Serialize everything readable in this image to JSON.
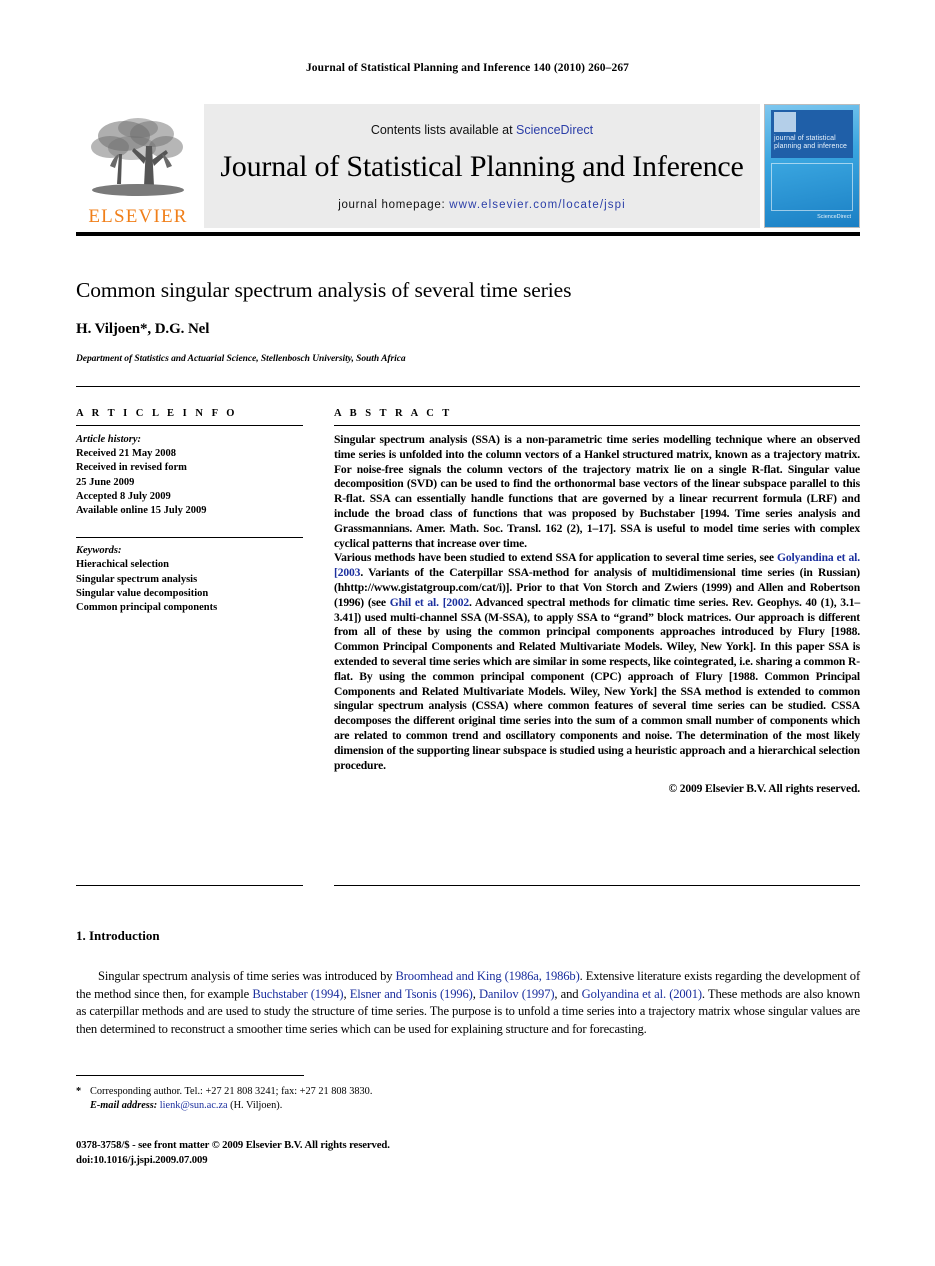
{
  "running_head": "Journal of Statistical Planning and Inference 140 (2010) 260–267",
  "masthead": {
    "publisher_name": "ELSEVIER",
    "contents_prefix": "Contents lists available at ",
    "contents_link": "ScienceDirect",
    "journal_title": "Journal of Statistical Planning and Inference",
    "homepage_prefix": "journal homepage: ",
    "homepage_url": "www.elsevier.com/locate/jspi",
    "cover": {
      "journal_name_lines": "journal of statistical planning and inference",
      "badge": "ScienceDirect"
    },
    "link_color": "#2b3ea8",
    "elsevier_orange": "#F07F1A"
  },
  "title_block": {
    "title": "Common singular spectrum analysis of several time series",
    "authors": "H. Viljoen*, D.G. Nel",
    "affiliation": "Department of Statistics and Actuarial Science, Stellenbosch University, South Africa"
  },
  "article_info": {
    "heading": "A R T I C L E   I N F O",
    "history_label": "Article history:",
    "history_lines": [
      "Received 21 May 2008",
      "Received in revised form",
      "25 June 2009",
      "Accepted 8 July 2009",
      "Available online 15 July 2009"
    ],
    "keywords_label": "Keywords:",
    "keywords": [
      "Hierachical selection",
      "Singular spectrum analysis",
      "Singular value decomposition",
      "Common principal components"
    ]
  },
  "abstract": {
    "heading": "A B S T R A C T",
    "paragraph1_part1": "Singular spectrum analysis (SSA) is a non-parametric time series modelling technique where an observed time series is unfolded into the column vectors of a Hankel structured matrix, known as a trajectory matrix. For noise-free signals the column vectors of the trajectory matrix lie on a single R-flat. Singular value decomposition (SVD) can be used to find the orthonormal base vectors of the linear subspace parallel to this R-flat. SSA can essentially handle functions that are governed by a linear recurrent formula (LRF) and include the broad class of functions that was proposed by Buchstaber [1994. Time series analysis and Grassmannians. Amer. Math. Soc. Transl. 162 (2), 1–17]. SSA is useful to model time series with complex cyclical patterns that increase over time.",
    "paragraph2_part1": "Various methods have been studied to extend SSA for application to several time series, see ",
    "paragraph2_cite1": "Golyandina et al. [2003",
    "paragraph2_part2": ". Variants of the Caterpillar SSA-method for analysis of multidimensional time series (in Russian) (h",
    "paragraph2_part2b": "http://www.gistatgroup.com/cat/i)]. Prior to that Von Storch and Zwiers (1999) and Allen and Robertson (1996) (see ",
    "paragraph2_cite2": "Ghil et al. [2002",
    "paragraph2_part3": ". Advanced spectral methods for climatic time series. Rev. Geophys. 40 (1), 3.1–3.41]) used multi-channel SSA (M-SSA), to apply SSA to “grand” block matrices. Our approach is different from all of these by using the common principal components approaches introduced by Flury [1988. Common Principal Components and Related Multivariate Models. Wiley, New York]. In this paper SSA is extended to several time series which are similar in some respects, like cointegrated, i.e. sharing a common R-flat. By using the common principal component (CPC) approach of Flury [1988. Common Principal Components and Related Multivariate Models. Wiley, New York] the SSA method is extended to common singular spectrum analysis (CSSA) where common features of several time series can be studied. CSSA decomposes the different original time series into the sum of a common small number of components which are related to common trend and oscillatory components and noise. The determination of the most likely dimension of the supporting linear subspace is studied using a heuristic approach and a hierarchical selection procedure.",
    "copyright": "© 2009 Elsevier B.V. All rights reserved."
  },
  "introduction": {
    "heading": "1. Introduction",
    "text_1": "Singular spectrum analysis of time series was introduced by ",
    "cite_1": "Broomhead and King (1986a, 1986b)",
    "text_2": ". Extensive literature exists regarding the development of the method since then, for example ",
    "cite_2": "Buchstaber (1994)",
    "text_3": ", ",
    "cite_3": "Elsner and Tsonis (1996)",
    "text_4": ", ",
    "cite_4": "Danilov (1997)",
    "text_5": ", and ",
    "cite_5": "Golyandina et al. (2001)",
    "text_6": ". These methods are also known as caterpillar methods and are used to study the structure of time series. The purpose is to unfold a time series into a trajectory matrix whose singular values are then determined to reconstruct a smoother time series which can be used for explaining structure and for forecasting."
  },
  "footnotes": {
    "star": "*",
    "corresponding": "Corresponding author. Tel.: +27 21 808 3241; fax: +27 21 808 3830.",
    "email_label": "E-mail address:",
    "email": "lienk@sun.ac.za",
    "email_suffix": " (H. Viljoen)."
  },
  "imprint": {
    "line1": "0378-3758/$ - see front matter © 2009 Elsevier B.V. All rights reserved.",
    "line2": "doi:10.1016/j.jspi.2009.07.009"
  }
}
